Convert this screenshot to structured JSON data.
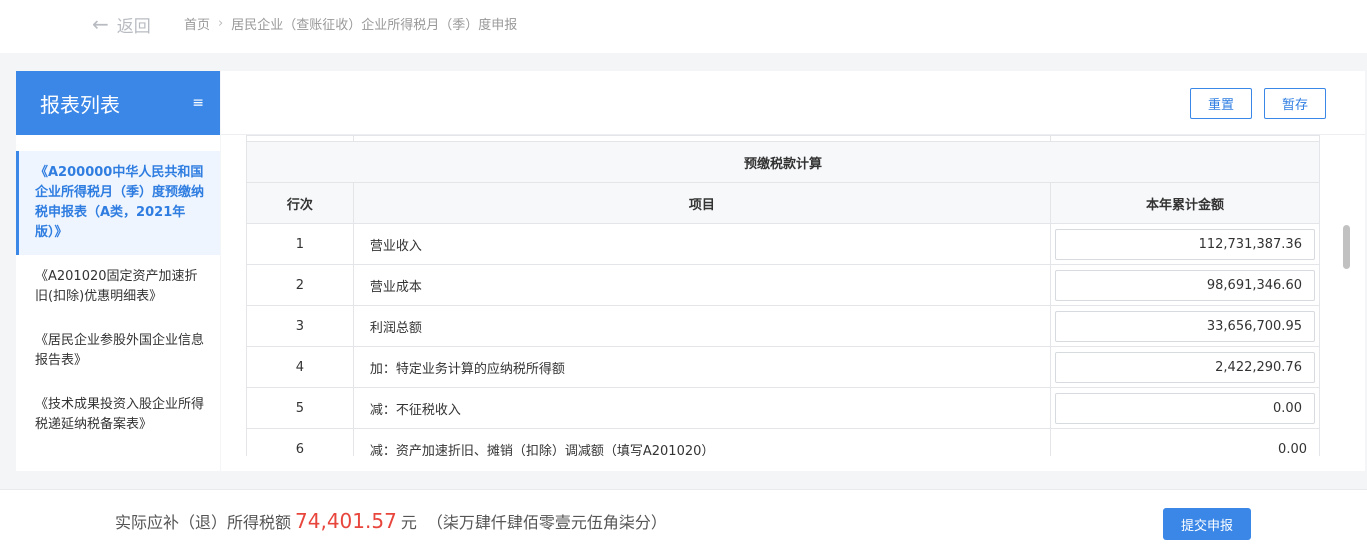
{
  "header": {
    "back_label": "返回",
    "breadcrumb": [
      "首页",
      "居民企业（查账征收）企业所得税月（季）度申报"
    ]
  },
  "sidebar": {
    "title": "报表列表",
    "items": [
      {
        "label": "《A200000中华人民共和国企业所得税月（季）度预缴纳税申报表（A类，2021年版）》"
      },
      {
        "label": "《A201020固定资产加速折旧(扣除)优惠明细表》"
      },
      {
        "label": "《居民企业参股外国企业信息报告表》"
      },
      {
        "label": "《技术成果投资入股企业所得税递延纳税备案表》"
      }
    ]
  },
  "toolbar": {
    "reset_label": "重置",
    "save_label": "暂存"
  },
  "table": {
    "section_title": "预缴税款计算",
    "columns": [
      "行次",
      "项目",
      "本年累计金额"
    ],
    "rows": [
      {
        "no": "1",
        "item": "营业收入",
        "amount": "112,731,387.36"
      },
      {
        "no": "2",
        "item": "营业成本",
        "amount": "98,691,346.60"
      },
      {
        "no": "3",
        "item": "利润总额",
        "amount": "33,656,700.95"
      },
      {
        "no": "4",
        "item": "加：特定业务计算的应纳税所得额",
        "amount": "2,422,290.76"
      },
      {
        "no": "5",
        "item": "减：不征税收入",
        "amount": "0.00"
      },
      {
        "no": "6",
        "item": "减：资产加速折旧、摊销（扣除）调减额（填写A201020）",
        "amount": "0.00"
      }
    ]
  },
  "footer": {
    "label": "实际应补（退）所得税额",
    "amount": "74,401.57",
    "unit": "元",
    "amount_upper": "（柒万肆仟肆佰零壹元伍角柒分）",
    "submit_label": "提交申报"
  },
  "colors": {
    "accent": "#3b87e8",
    "amount": "#e8453c"
  }
}
